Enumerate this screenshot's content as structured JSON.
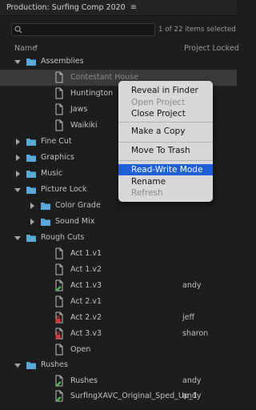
{
  "panel": {
    "title": "Production: Surfing Comp 2020",
    "menu_icon": "hamburger-icon"
  },
  "search": {
    "value": "",
    "placeholder": "",
    "count_text": "1 of 22 items selected"
  },
  "columns": {
    "name": "Name",
    "sort_glyph": "↑",
    "locked": "Project Locked"
  },
  "tree": [
    {
      "label": "Assemblies",
      "kind": "folder",
      "expanded": true,
      "lock": ""
    },
    {
      "label": "Contestant House",
      "kind": "project",
      "selected": true,
      "lock": ""
    },
    {
      "label": "Huntington",
      "kind": "project",
      "lock": ""
    },
    {
      "label": "Jaws",
      "kind": "project",
      "lock": ""
    },
    {
      "label": "Waikiki",
      "kind": "project",
      "lock": ""
    },
    {
      "label": "Fine Cut",
      "kind": "folder",
      "expanded": false,
      "lock": ""
    },
    {
      "label": "Graphics",
      "kind": "folder",
      "expanded": false,
      "lock": ""
    },
    {
      "label": "Music",
      "kind": "folder",
      "expanded": false,
      "lock": ""
    },
    {
      "label": "Picture Lock",
      "kind": "folder",
      "expanded": true,
      "lock": ""
    },
    {
      "label": "Color Grade",
      "kind": "folder",
      "expanded": false,
      "lock": ""
    },
    {
      "label": "Sound Mix",
      "kind": "folder",
      "expanded": false,
      "lock": ""
    },
    {
      "label": "Rough Cuts",
      "kind": "folder",
      "expanded": true,
      "lock": ""
    },
    {
      "label": "Act 1.v1",
      "kind": "project",
      "lock": ""
    },
    {
      "label": "Act 1.v2",
      "kind": "project",
      "lock": ""
    },
    {
      "label": "Act 1.v3",
      "kind": "project-edit",
      "lock": "andy"
    },
    {
      "label": "Act 2.v1",
      "kind": "project",
      "lock": ""
    },
    {
      "label": "Act 2.v2",
      "kind": "project-locked",
      "lock": "jeff"
    },
    {
      "label": "Act 3.v3",
      "kind": "project-locked",
      "lock": "sharon"
    },
    {
      "label": "Open",
      "kind": "project",
      "lock": ""
    },
    {
      "label": "Rushes",
      "kind": "folder",
      "expanded": true,
      "lock": ""
    },
    {
      "label": "Rushes",
      "kind": "project-edit",
      "lock": "andy"
    },
    {
      "label": "SurfingXAVC_Original_Sped_Up_1",
      "kind": "project-edit",
      "lock": "andy"
    }
  ],
  "context_menu": {
    "items": [
      {
        "label": "Reveal in Finder",
        "enabled": true
      },
      {
        "label": "Open Project",
        "enabled": false
      },
      {
        "label": "Close Project",
        "enabled": true
      },
      {
        "label": "Make a Copy",
        "enabled": true
      },
      {
        "label": "Move To Trash",
        "enabled": true
      },
      {
        "label": "Read-Write Mode",
        "enabled": true,
        "highlighted": true
      },
      {
        "label": "Rename",
        "enabled": true
      },
      {
        "label": "Refresh",
        "enabled": false
      }
    ]
  },
  "colors": {
    "folder": "#5aa9d8",
    "highlight": "#1f5fd6",
    "edit_badge": "#4fbf4f",
    "lock_badge": "#d63a3a"
  }
}
